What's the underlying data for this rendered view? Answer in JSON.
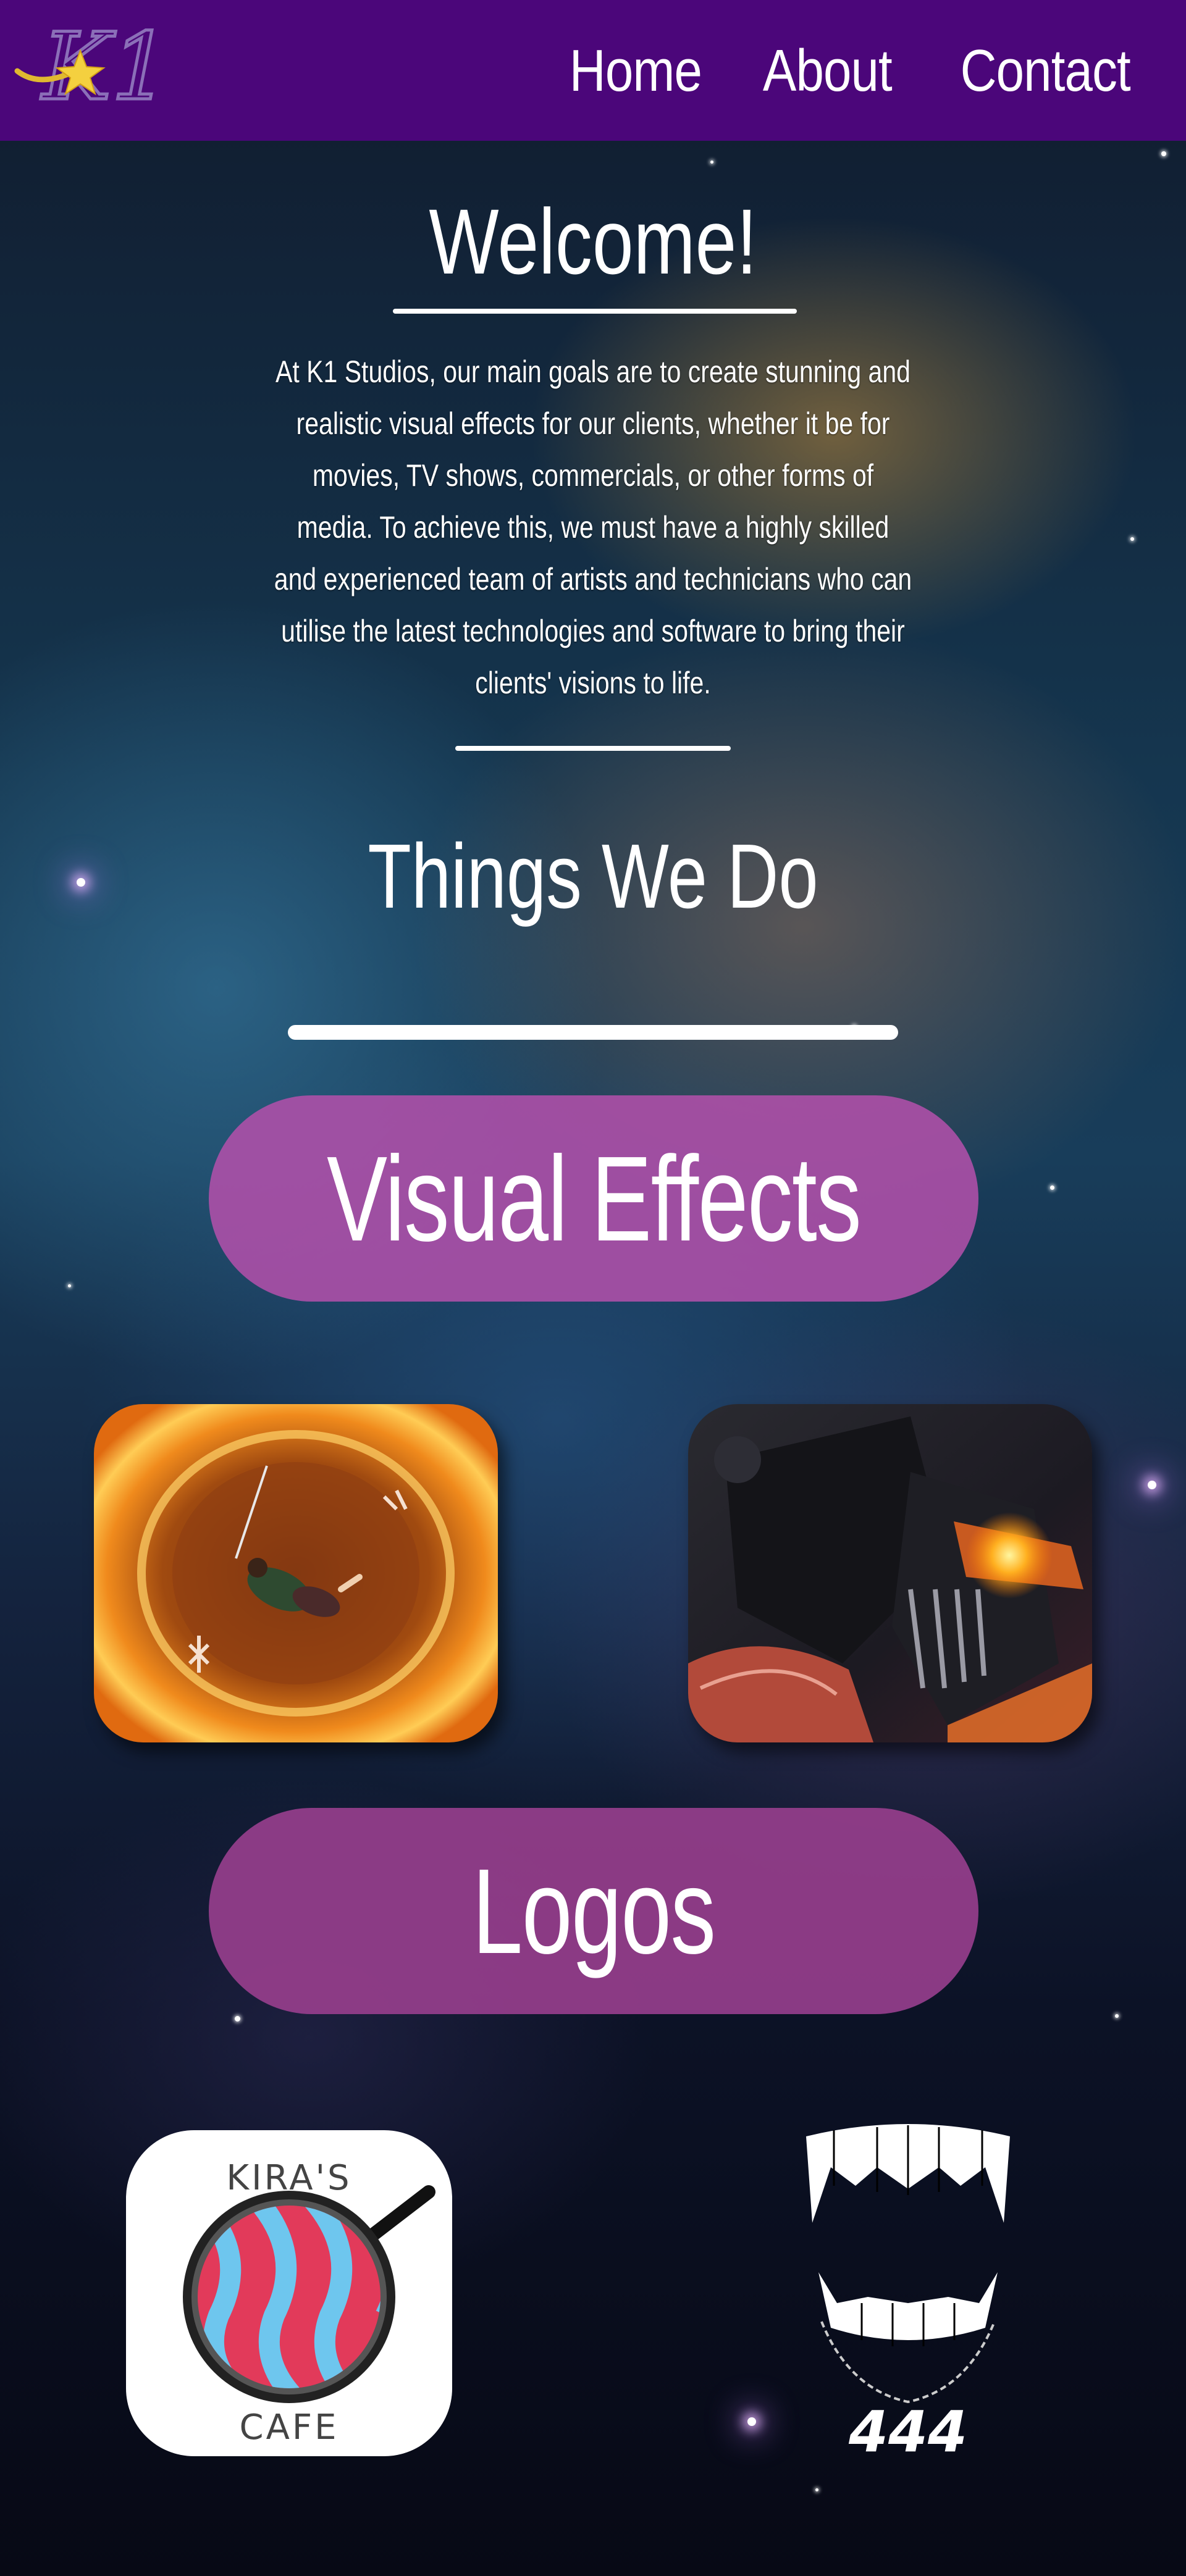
{
  "navbar": {
    "logo_text": "K1",
    "links": [
      "Home",
      "About",
      "Contact"
    ],
    "background": "#4b067a"
  },
  "welcome": {
    "title": "Welcome!",
    "paragraph": "At K1 Studios, our main goals are to create stunning and realistic visual effects for our clients, whether it be for movies, TV shows, commercials, or other forms of media. To achieve this, we must have a highly skilled and experienced team of artists and technicians who can utilise the latest technologies and software to bring their clients' visions to life."
  },
  "services": {
    "title": "Things We Do",
    "visual_effects_label": "Visual Effects",
    "logos_label": "Logos",
    "pill_color": "#a24aa0"
  },
  "logos": {
    "cafe_top": "KIRA'S",
    "cafe_bottom": "CAFE",
    "fangs_text": "444"
  }
}
